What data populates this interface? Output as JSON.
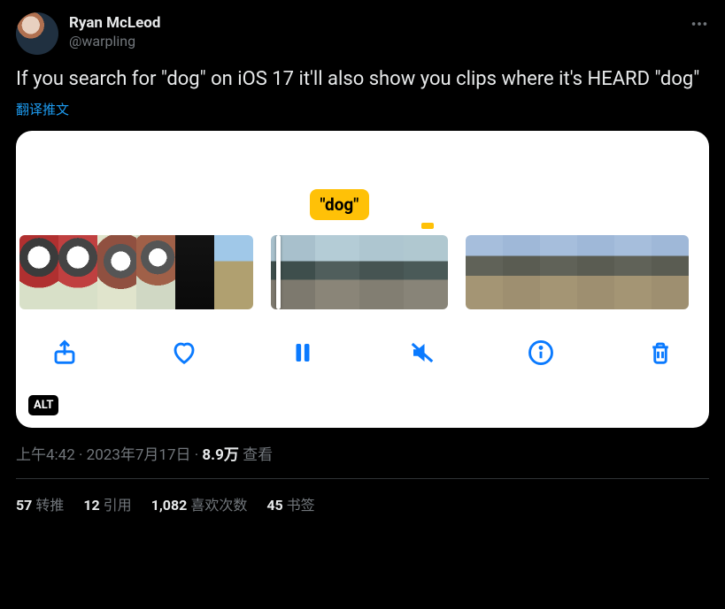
{
  "author": {
    "display_name": "Ryan McLeod",
    "handle": "@warpling"
  },
  "body_text": "If you search for \"dog\" on iOS 17 it'll also show you clips where it's HEARD \"dog\"",
  "translate_label": "翻译推文",
  "media": {
    "bubble_text": "\"dog\"",
    "alt_badge": "ALT"
  },
  "meta": {
    "time": "上午4:42",
    "dot1": " · ",
    "date": "2023年7月17日",
    "dot2": " · ",
    "views_number": "8.9万",
    "views_label": " 查看"
  },
  "stats": {
    "retweets": {
      "num": "57",
      "label": " 转推"
    },
    "quotes": {
      "num": "12",
      "label": " 引用"
    },
    "likes": {
      "num": "1,082",
      "label": " 喜欢次数"
    },
    "bookmarks": {
      "num": "45",
      "label": " 书签"
    }
  }
}
